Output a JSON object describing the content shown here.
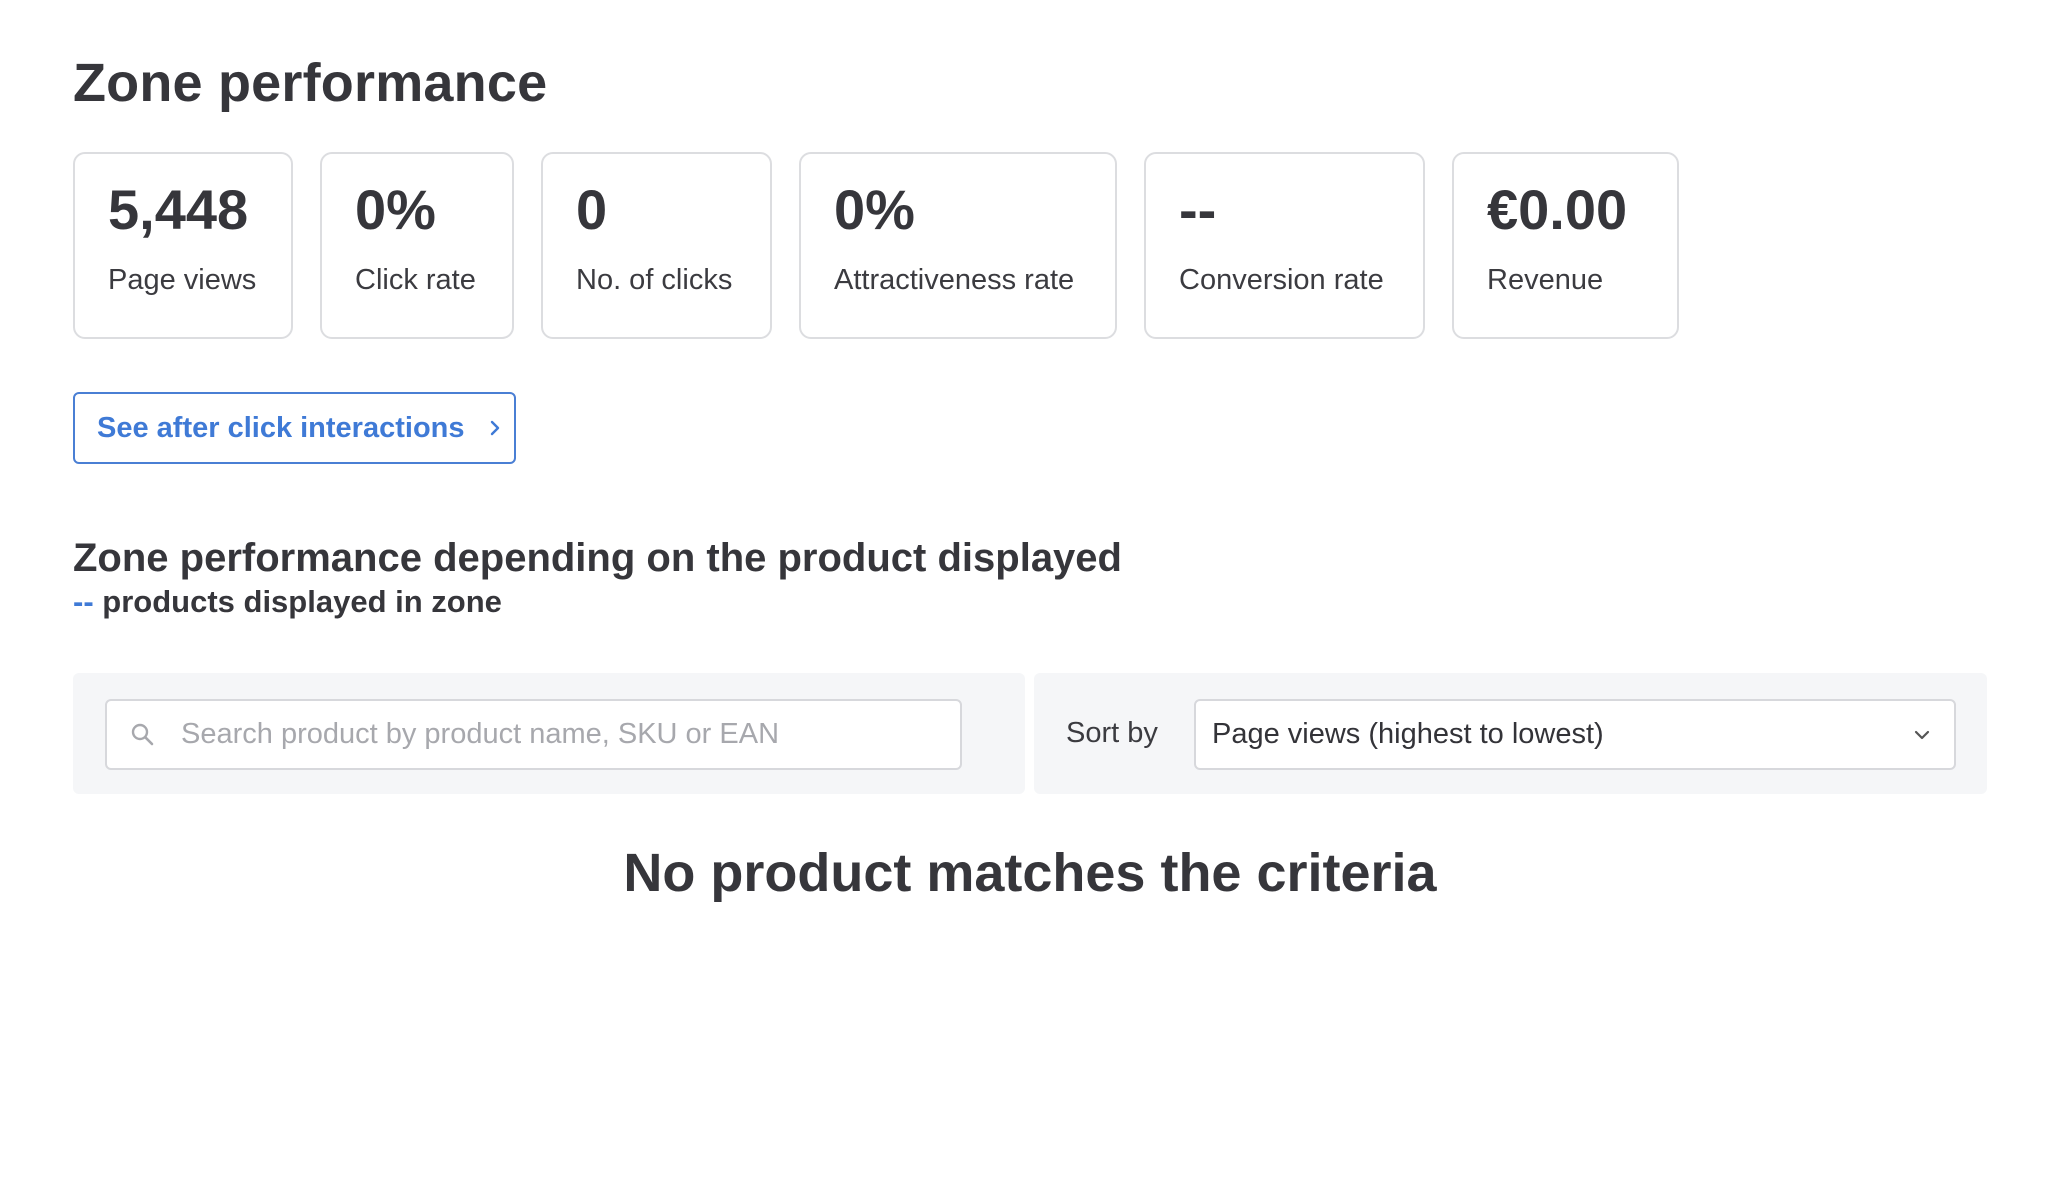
{
  "header": {
    "title": "Zone performance"
  },
  "kpis": [
    {
      "value": "5,448",
      "label": "Page views"
    },
    {
      "value": "0%",
      "label": "Click rate"
    },
    {
      "value": "0",
      "label": "No. of clicks"
    },
    {
      "value": "0%",
      "label": "Attractiveness rate"
    },
    {
      "value": "--",
      "label": "Conversion rate"
    },
    {
      "value": "€0.00",
      "label": "Revenue"
    }
  ],
  "after_click": {
    "label": "See after click interactions",
    "icon": "chevron-right-icon"
  },
  "products_section": {
    "title": "Zone performance depending on the product displayed",
    "count": "--",
    "subtitle_suffix": "products displayed in zone"
  },
  "search": {
    "placeholder": "Search product by product name, SKU or EAN",
    "value": "",
    "icon": "search-icon"
  },
  "sort": {
    "label": "Sort by",
    "selected": "Page views (highest to lowest)",
    "icon": "chevron-down-icon"
  },
  "empty_state": {
    "message": "No product matches the criteria"
  },
  "colors": {
    "accent": "#3f7ad6",
    "text": "#36363b",
    "border": "#dcdde0",
    "panel_bg": "#f5f6f8"
  }
}
